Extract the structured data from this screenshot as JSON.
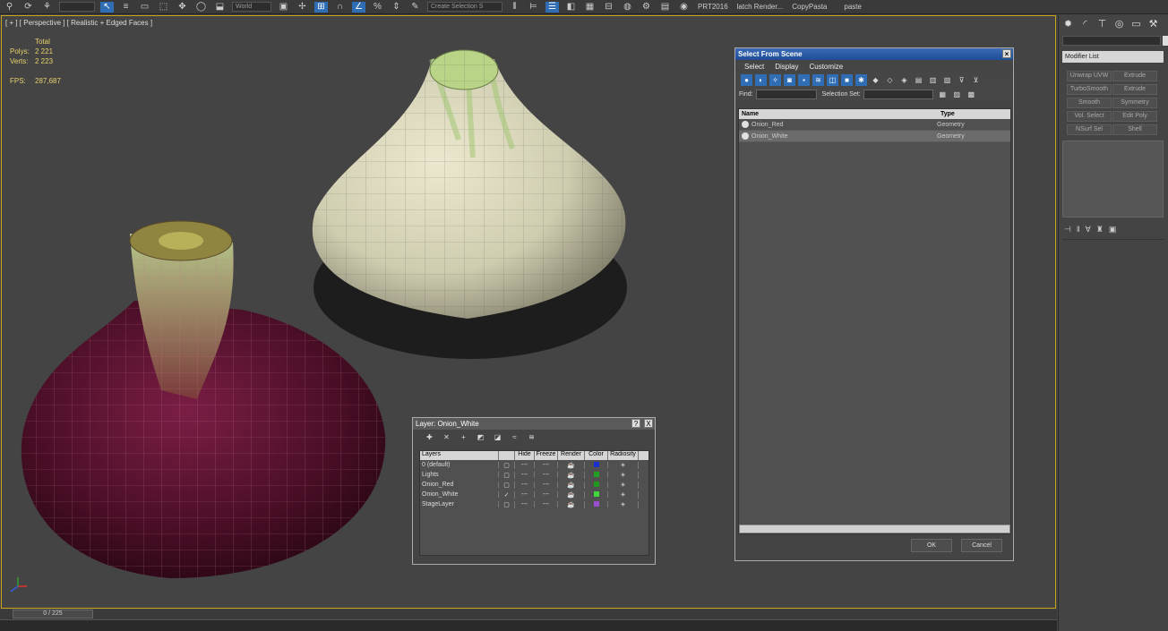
{
  "toolbar": {
    "ref_coord": "World",
    "selection_set_placeholder": "Create Selection S",
    "labels": [
      "PRT2016",
      "latch Render...",
      "CopyPasta",
      "paste"
    ]
  },
  "viewport": {
    "label": "[ + ] [ Perspective ] [ Realistic + Edged Faces ]",
    "stats": {
      "total_label": "Total",
      "polys_label": "Polys:",
      "polys_value": "2 221",
      "verts_label": "Verts:",
      "verts_value": "2 223",
      "fps_label": "FPS:",
      "fps_value": "287,687"
    }
  },
  "select_from_scene": {
    "title": "Select From Scene",
    "menus": [
      "Select",
      "Display",
      "Customize"
    ],
    "find_label": "Find:",
    "selection_set_label": "Selection Set:",
    "columns": {
      "name": "Name",
      "type": "Type"
    },
    "rows": [
      {
        "name": "Onion_Red",
        "type": "Geometry"
      },
      {
        "name": "Onion_White",
        "type": "Geometry"
      }
    ],
    "ok_label": "OK",
    "cancel_label": "Cancel"
  },
  "layer_dialog": {
    "title": "Layer: Onion_White",
    "help": "?",
    "close": "X",
    "columns": {
      "layers": "Layers",
      "hide": "Hide",
      "freeze": "Freeze",
      "render": "Render",
      "color": "Color",
      "radiosity": "Radiosity"
    },
    "rows": [
      {
        "name": "0 (default)",
        "color": "#1a2fd0"
      },
      {
        "name": "Lights",
        "color": "#22a022"
      },
      {
        "name": "Onion_Red",
        "color": "#1f9a1f"
      },
      {
        "name": "Onion_White",
        "color": "#3fd83f"
      },
      {
        "name": "StageLayer",
        "color": "#9a4fd0"
      }
    ]
  },
  "command_panel": {
    "modifier_list": "Modifier List",
    "buttons": [
      "Unwrap UVW",
      "Extrude",
      "TurboSmooth",
      "Extrude",
      "Smooth",
      "Symmetry",
      "Vol. Select",
      "Edit Poly",
      "NSurf Sel",
      "Shell"
    ]
  },
  "timeline": {
    "frame": "0 / 225"
  },
  "colors": {
    "accent": "#2f6db5",
    "viewport_border": "#c9a317",
    "stats": "#e8d26a"
  }
}
